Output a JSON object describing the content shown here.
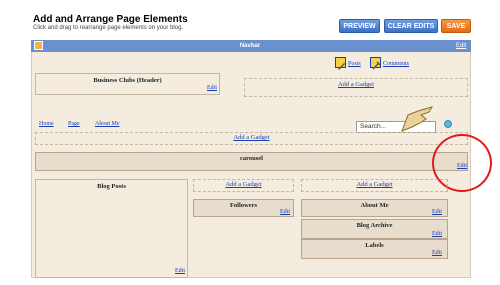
{
  "header": {
    "title": "Add and Arrange Page Elements",
    "subtitle": "Click and drag to rearrange page elements on your blog."
  },
  "toolbar": {
    "preview_label": "PREVIEW",
    "clear_edits_label": "CLEAR EDITS",
    "save_label": "SAVE"
  },
  "navbar": {
    "label": "Navbar",
    "edit": "Edit"
  },
  "header_section": {
    "title": "Business Clubs (Header)",
    "edit": "Edit",
    "quick_links": [
      {
        "label": "Posts",
        "icon": "pencil-icon"
      },
      {
        "label": "Comments",
        "icon": "wrench-icon"
      }
    ],
    "add_gadget": "Add a Gadget"
  },
  "tabs": [
    "Home",
    "Page",
    "About Me"
  ],
  "search": {
    "value": "Search..."
  },
  "crossbar": {
    "add_gadget": "Add a Gadget"
  },
  "carousel": {
    "title": "carousel",
    "edit": "Edit"
  },
  "main": {
    "title": "Blog Posts",
    "edit": "Edit"
  },
  "sidebar1": {
    "add_gadget": "Add a Gadget",
    "widgets": [
      {
        "title": "Followers",
        "edit": "Edit"
      }
    ]
  },
  "sidebar2": {
    "add_gadget": "Add a Gadget",
    "widgets": [
      {
        "title": "About Me",
        "edit": "Edit"
      },
      {
        "title": "Blog Archive",
        "edit": "Edit"
      },
      {
        "title": "Labels",
        "edit": "Edit"
      }
    ]
  },
  "colors": {
    "navbar": "#6a90cd",
    "highlight": "#e0191b",
    "canvas": "#f5ece0"
  }
}
